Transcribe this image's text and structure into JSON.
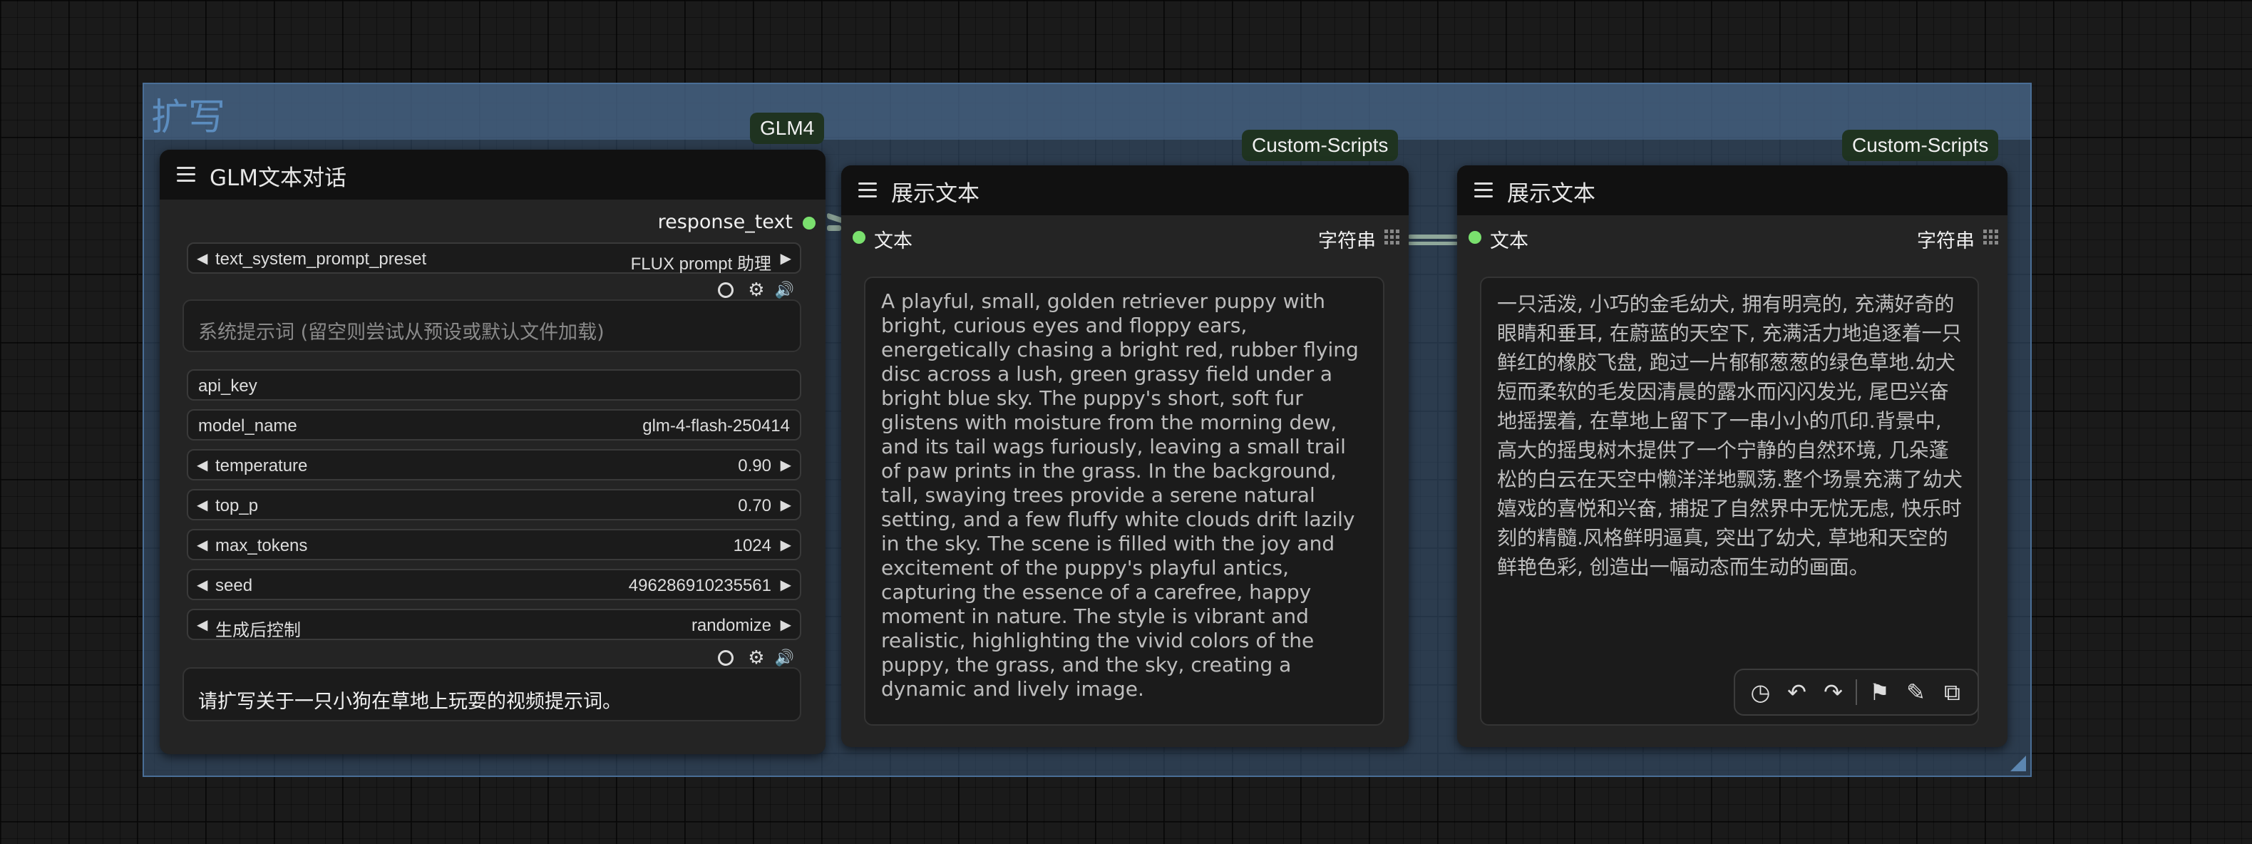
{
  "group": {
    "title": "扩写"
  },
  "glm_node": {
    "badge": "GLM4",
    "title": "GLM文本对话",
    "output_label": "response_text",
    "widgets": {
      "preset": {
        "label": "text_system_prompt_preset",
        "value": "FLUX prompt 助理"
      },
      "system_prompt_placeholder": "系统提示词 (留空则尝试从预设或默认文件加载)",
      "api_key": {
        "label": "api_key"
      },
      "model_name": {
        "label": "model_name",
        "value": "glm-4-flash-250414"
      },
      "temperature": {
        "label": "temperature",
        "value": "0.90"
      },
      "top_p": {
        "label": "top_p",
        "value": "0.70"
      },
      "max_tokens": {
        "label": "max_tokens",
        "value": "1024"
      },
      "seed": {
        "label": "seed",
        "value": "496286910235561"
      },
      "control_after": {
        "label": "生成后控制",
        "value": "randomize"
      }
    },
    "user_prompt": "请扩写关于一只小狗在草地上玩耍的视频提示词。"
  },
  "display_node_1": {
    "badge": "Custom-Scripts",
    "title": "展示文本",
    "input_label": "文本",
    "output_label": "字符串",
    "text": "A playful, small, golden retriever puppy with bright, curious eyes and floppy ears, energetically chasing a bright red, rubber flying disc across a lush, green grassy field under a bright blue sky. The puppy's short, soft fur glistens with moisture from the morning dew, and its tail wags furiously, leaving a small trail of paw prints in the grass. In the background, tall, swaying trees provide a serene natural setting, and a few fluffy white clouds drift lazily in the sky. The scene is filled with the joy and excitement of the puppy's playful antics, capturing the essence of a carefree, happy moment in nature. The style is vibrant and realistic, highlighting the vivid colors of the puppy, the grass, and the sky, creating a dynamic and lively image."
  },
  "display_node_2": {
    "badge": "Custom-Scripts",
    "title": "展示文本",
    "input_label": "文本",
    "output_label": "字符串",
    "text": "一只活泼, 小巧的金毛幼犬, 拥有明亮的, 充满好奇的眼睛和垂耳, 在蔚蓝的天空下, 充满活力地追逐着一只鲜红的橡胶飞盘, 跑过一片郁郁葱葱的绿色草地.幼犬短而柔软的毛发因清晨的露水而闪闪发光, 尾巴兴奋地摇摆着, 在草地上留下了一串小小的爪印.背景中, 高大的摇曳树木提供了一个宁静的自然环境, 几朵蓬松的白云在天空中懒洋洋地飘荡.整个场景充满了幼犬嬉戏的喜悦和兴奋, 捕捉了自然界中无忧无虑, 快乐时刻的精髓.风格鲜明逼真, 突出了幼犬, 草地和天空的鲜艳色彩, 创造出一幅动态而生动的画面。"
  },
  "toolbar": {
    "icons": [
      "history-icon",
      "undo-icon",
      "redo-icon",
      "bookmark-icon",
      "magic-wand-icon",
      "translate-icon"
    ]
  },
  "colors": {
    "slot_dot": "#7ae06e",
    "group_fill": "#3d5a7a",
    "badge_bg": "#1f3320"
  }
}
